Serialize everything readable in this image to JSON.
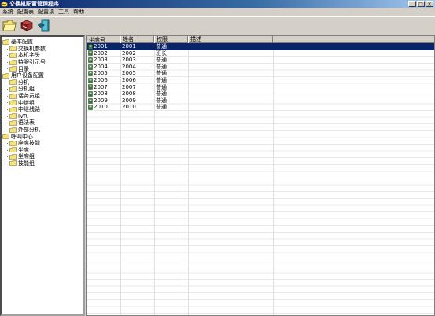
{
  "window": {
    "title": "交换机配置管理程序",
    "controls": [
      "_",
      "□",
      "×"
    ]
  },
  "menu": [
    "系统",
    "配置表",
    "配置项",
    "工具",
    "帮助"
  ],
  "toolbar": [
    {
      "name": "open-folder-button",
      "icon": "folder-open-icon"
    },
    {
      "name": "books-button",
      "icon": "books-icon"
    },
    {
      "name": "exit-button",
      "icon": "exit-door-icon"
    }
  ],
  "tree": [
    {
      "label": "基本配置",
      "level": 0
    },
    {
      "label": "交换机参数",
      "level": 1
    },
    {
      "label": "本机字头",
      "level": 1
    },
    {
      "label": "特服引示号",
      "level": 1
    },
    {
      "label": "目录",
      "level": 1
    },
    {
      "label": "用户设备配置",
      "level": 0
    },
    {
      "label": "分机",
      "level": 1
    },
    {
      "label": "分机组",
      "level": 1
    },
    {
      "label": "话务员组",
      "level": 1
    },
    {
      "label": "中继组",
      "level": 1
    },
    {
      "label": "中继线路",
      "level": 1
    },
    {
      "label": "IVR",
      "level": 1
    },
    {
      "label": "语法表",
      "level": 1
    },
    {
      "label": "外部分机",
      "level": 1
    },
    {
      "label": "呼叫中心",
      "level": 0
    },
    {
      "label": "座席技能",
      "level": 1
    },
    {
      "label": "坐席",
      "level": 1
    },
    {
      "label": "坐席组",
      "level": 1
    },
    {
      "label": "技能组",
      "level": 1
    }
  ],
  "grid": {
    "columns": [
      "坐席号",
      "姓名",
      "权限",
      "描述"
    ],
    "rows": [
      {
        "id": "2001",
        "name": "2001",
        "perm": "普通",
        "desc": "",
        "selected": true
      },
      {
        "id": "2002",
        "name": "2002",
        "perm": "班长",
        "desc": ""
      },
      {
        "id": "2003",
        "name": "2003",
        "perm": "普通",
        "desc": ""
      },
      {
        "id": "2004",
        "name": "2004",
        "perm": "普通",
        "desc": ""
      },
      {
        "id": "2005",
        "name": "2005",
        "perm": "普通",
        "desc": ""
      },
      {
        "id": "2006",
        "name": "2006",
        "perm": "普通",
        "desc": ""
      },
      {
        "id": "2007",
        "name": "2007",
        "perm": "普通",
        "desc": ""
      },
      {
        "id": "2008",
        "name": "2008",
        "perm": "普通",
        "desc": ""
      },
      {
        "id": "2009",
        "name": "2009",
        "perm": "普通",
        "desc": ""
      },
      {
        "id": "2010",
        "name": "2010",
        "perm": "普通",
        "desc": ""
      }
    ]
  },
  "colors": {
    "titlebar": "#0a246a",
    "selection": "#0a246a",
    "folder": "#f5e27a",
    "face": "#d4d0c8"
  }
}
